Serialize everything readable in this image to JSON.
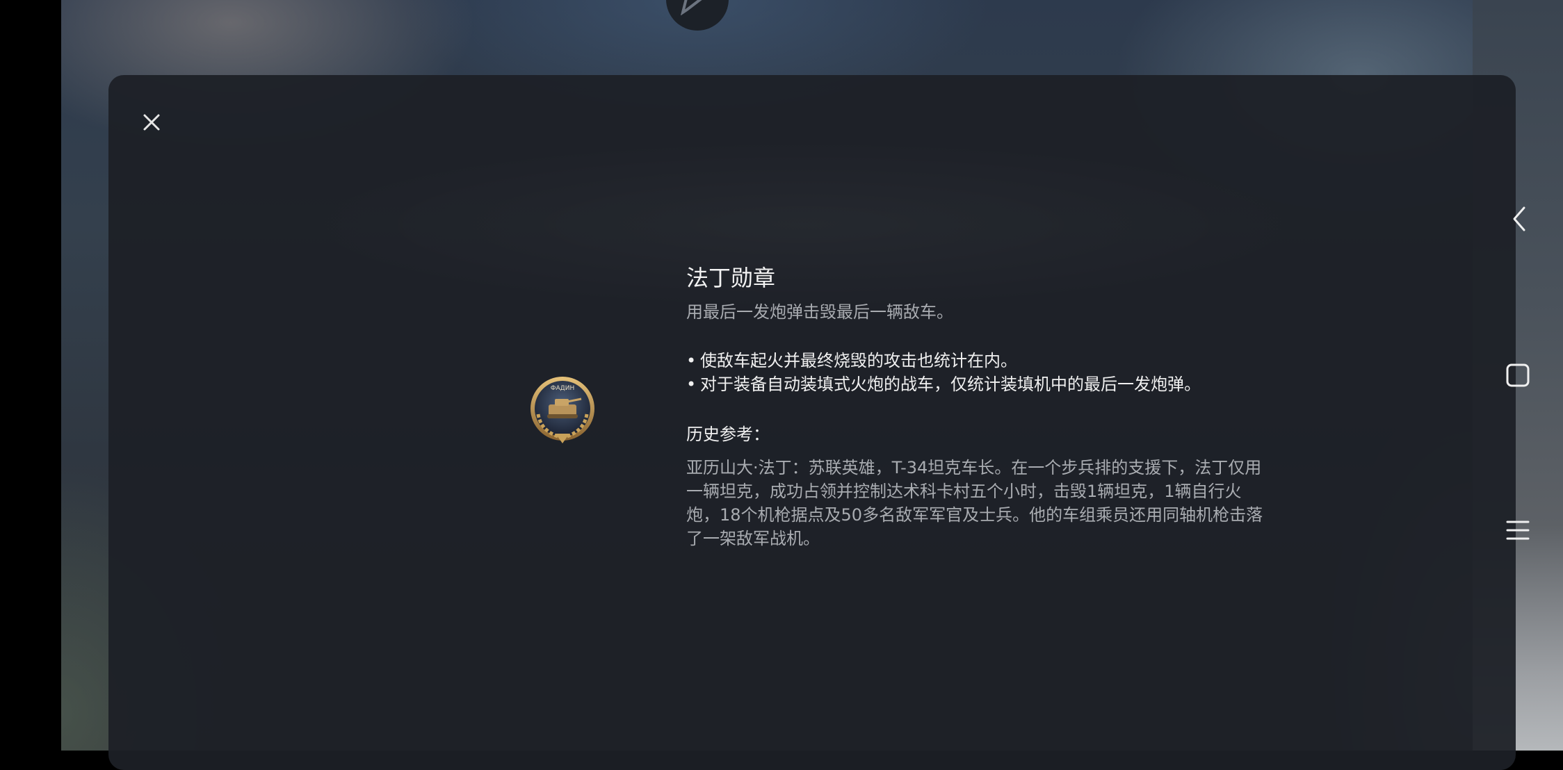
{
  "modal": {
    "title": "法丁勋章",
    "subtitle": "用最后一发炮弹击毁最后一辆敌车。",
    "bullets": [
      "使敌车起火并最终烧毁的攻击也统计在内。",
      "对于装备自动装填式火炮的战车，仅统计装填机中的最后一发炮弹。"
    ],
    "history_label": "历史参考：",
    "history_text": "亚历山大·法丁：苏联英雄，T-34坦克车长。在一个步兵排的支援下，法丁仅用一辆坦克，成功占领并控制达术科卡村五个小时，击毁1辆坦克，1辆自行火炮，18个机枪据点及50多名敌军军官及士兵。他的车组乘员还用同轴机枪击落了一架敌军战机。",
    "medal_inscription": "ФАДИН",
    "close_icon": "close-icon"
  },
  "system_nav": {
    "back_icon": "back-chevron-icon",
    "home_icon": "home-square-icon",
    "recents_icon": "menu-lines-icon"
  },
  "colors": {
    "modal_bg": "#1d2026",
    "title": "#f2f2f2",
    "secondary_text": "#a9acb1",
    "medal_gold": "#c9a25a"
  }
}
